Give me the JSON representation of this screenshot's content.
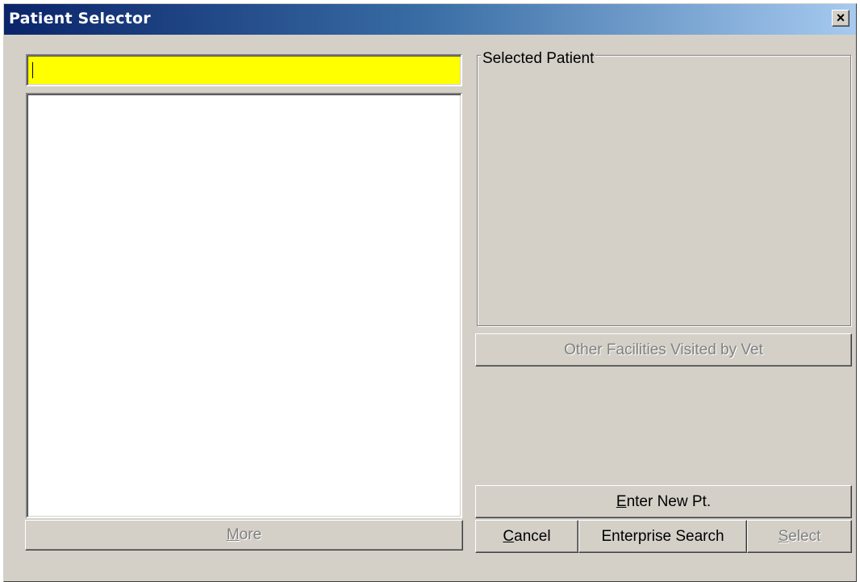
{
  "window": {
    "title": "Patient Selector",
    "close_glyph": "×"
  },
  "search": {
    "value": ""
  },
  "patient_list": {
    "items": []
  },
  "buttons": {
    "more": {
      "accel": "M",
      "rest": "ore"
    },
    "other_facilities": "Other Facilities Visited by Vet",
    "enter_new": {
      "accel": "E",
      "rest": "nter New Pt."
    },
    "cancel": {
      "accel": "C",
      "rest": "ancel"
    },
    "enterprise_search": "Enterprise Search",
    "select": {
      "accel": "S",
      "rest": "elect"
    }
  },
  "selected_patient": {
    "label": "Selected Patient"
  },
  "colors": {
    "search_bg": "#ffff00",
    "window_bg": "#d4d0c8",
    "title_start": "#0a246a",
    "title_end": "#a6caf0"
  }
}
